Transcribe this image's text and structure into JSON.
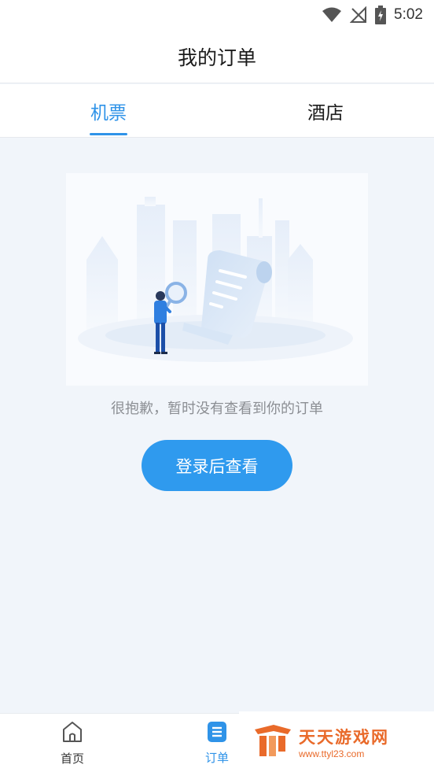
{
  "status_bar": {
    "time": "5:02",
    "icons": [
      "wifi-icon",
      "no-signal-icon",
      "battery-charging-icon"
    ]
  },
  "header": {
    "title": "我的订单"
  },
  "tabs": [
    {
      "label": "机票",
      "active": true
    },
    {
      "label": "酒店",
      "active": false
    }
  ],
  "empty_state": {
    "illustration": "empty-orders-illustration",
    "message": "很抱歉，暂时没有查看到你的订单",
    "button_label": "登录后查看"
  },
  "bottom_nav": {
    "items": [
      {
        "label": "首页",
        "icon": "home-icon",
        "active": false
      },
      {
        "label": "订单",
        "icon": "orders-icon",
        "active": true
      }
    ]
  },
  "watermark": {
    "title": "天天游戏网",
    "url": "www.ttyl23.com"
  },
  "colors": {
    "accent": "#2f93e8",
    "button": "#2f9aee",
    "background": "#f1f5fa",
    "watermark": "#e96a2a"
  }
}
